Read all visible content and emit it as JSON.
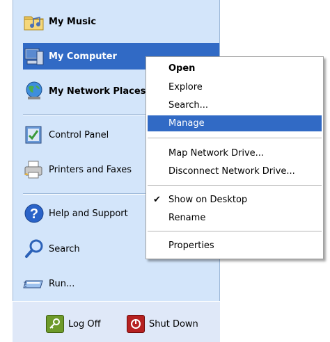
{
  "start_menu": {
    "items": [
      {
        "label": "My Music",
        "icon": "music-folder-icon"
      },
      {
        "label": "My Computer",
        "icon": "computer-icon"
      },
      {
        "label": "My Network Places",
        "icon": "network-icon"
      },
      {
        "label": "Control Panel",
        "icon": "control-panel-icon"
      },
      {
        "label": "Printers and Faxes",
        "icon": "printer-icon"
      },
      {
        "label": "Help and Support",
        "icon": "help-icon"
      },
      {
        "label": "Search",
        "icon": "search-icon"
      },
      {
        "label": "Run...",
        "icon": "run-icon"
      }
    ],
    "footer": {
      "logoff_label": "Log Off",
      "shutdown_label": "Shut Down"
    }
  },
  "context_menu": {
    "items": [
      {
        "label": "Open"
      },
      {
        "label": "Explore"
      },
      {
        "label": "Search..."
      },
      {
        "label": "Manage"
      },
      {
        "label": "Map Network Drive..."
      },
      {
        "label": "Disconnect Network Drive..."
      },
      {
        "label": "Show on Desktop"
      },
      {
        "label": "Rename"
      },
      {
        "label": "Properties"
      }
    ],
    "check_mark": "✔"
  },
  "colors": {
    "selection": "#316ac5",
    "panel": "#d3e5fa"
  }
}
